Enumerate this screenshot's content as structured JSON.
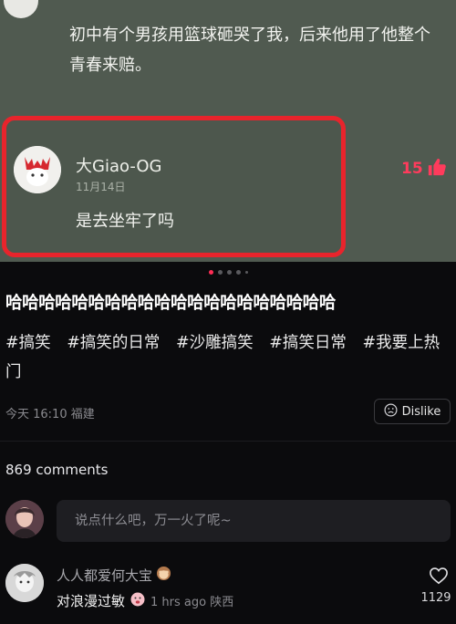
{
  "screenshot": {
    "comment_text": "初中有个男孩用篮球砸哭了我，后来他用了他整个青春来赔。",
    "highlighted_comment": {
      "username": "大Giao-OG",
      "date": "11月14日",
      "text": "是去坐牢了吗",
      "like_count": "15"
    },
    "highlight_color": "#e8242c",
    "like_color": "#ff3b5c"
  },
  "carousel": {
    "dots": 5,
    "active_index": 0
  },
  "post": {
    "caption": "哈哈哈哈哈哈哈哈哈哈哈哈哈哈哈哈哈哈哈哈",
    "hashtags": [
      "#搞笑",
      "#搞笑的日常",
      "#沙雕搞笑",
      "#搞笑日常",
      "#我要上热门"
    ],
    "time_location": "今天 16:10 福建",
    "dislike_label": "Dislike"
  },
  "comments_section": {
    "count_label": "869 comments",
    "input_placeholder": "说点什么吧，万一火了呢~",
    "comments": [
      {
        "username": "人人都爱何大宝",
        "text": "对浪漫过敏",
        "meta": "1 hrs ago 陕西",
        "likes": "1129"
      }
    ]
  },
  "colors": {
    "background": "#0b0b0d",
    "accent": "#ff2d55",
    "input_bg": "#1e1e22"
  }
}
